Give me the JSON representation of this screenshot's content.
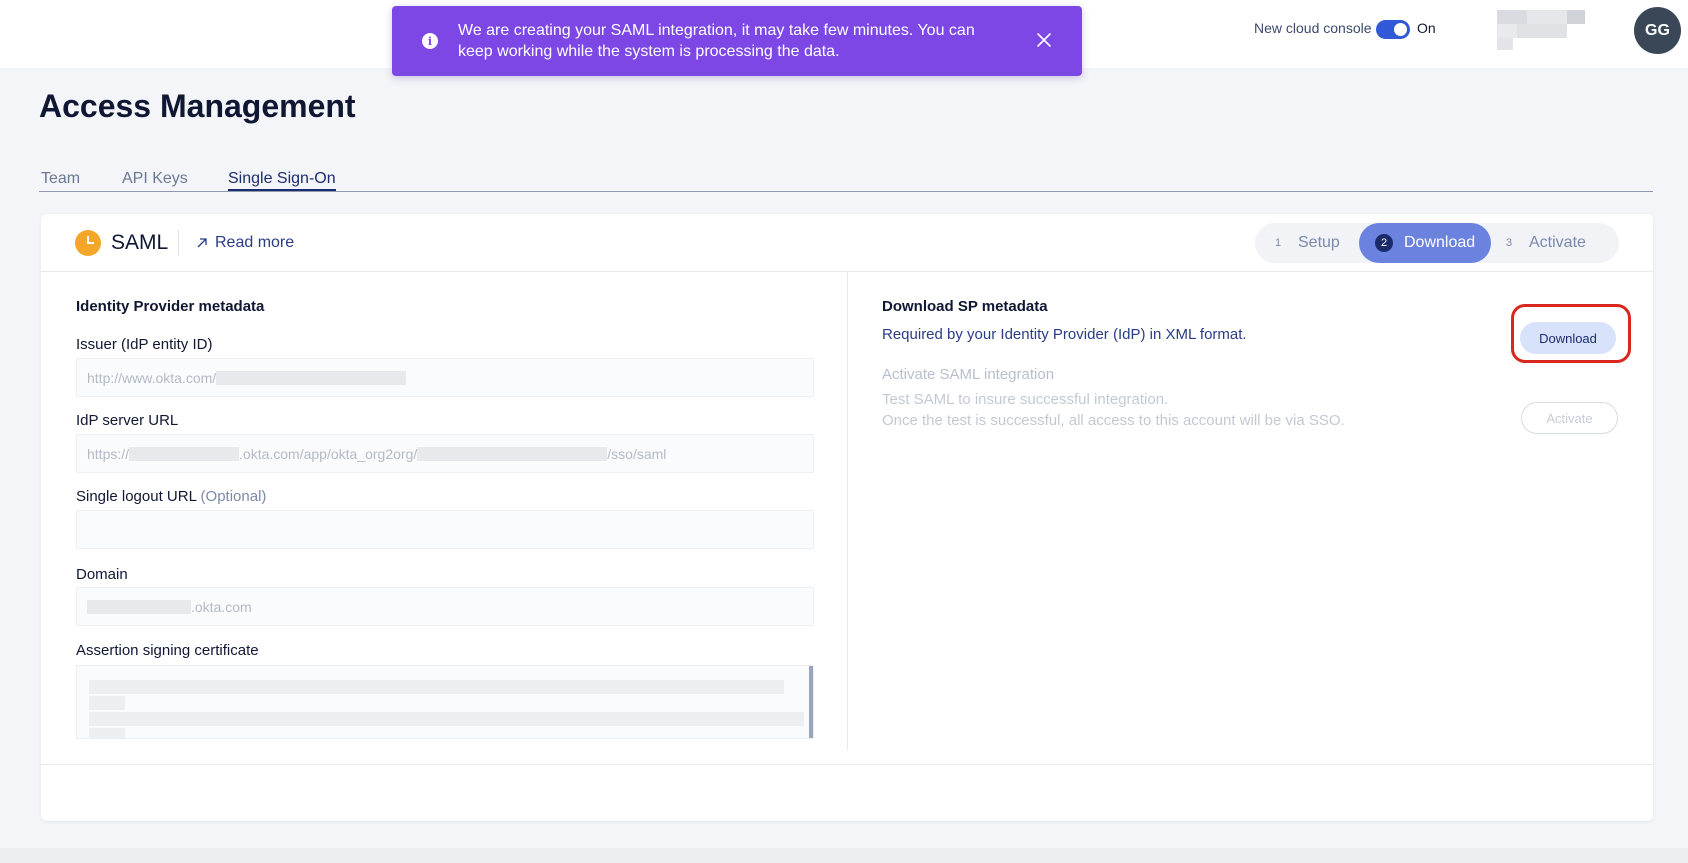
{
  "header": {
    "toast_message": "We are creating your SAML integration, it may take few minutes. You can keep working while the system is processing the data.",
    "console_label": "New cloud console",
    "console_toggle_state": "On",
    "avatar_initials": "GG"
  },
  "page": {
    "title": "Access Management",
    "tabs": [
      {
        "label": "Team"
      },
      {
        "label": "API Keys"
      },
      {
        "label": "Single Sign-On"
      }
    ],
    "active_tab": "Single Sign-On"
  },
  "card": {
    "title": "SAML",
    "read_more": "Read more",
    "steps": [
      {
        "num": "1",
        "label": "Setup"
      },
      {
        "num": "2",
        "label": "Download"
      },
      {
        "num": "3",
        "label": "Activate"
      }
    ],
    "active_step": "Download"
  },
  "idp": {
    "section_title": "Identity Provider metadata",
    "issuer_label": "Issuer (IdP entity ID)",
    "issuer_value_prefix": "http://www.okta.com/",
    "server_url_label": "IdP server URL",
    "server_url_a": "https://",
    "server_url_b": ".okta.com/app/okta_org2org/",
    "server_url_c": "/sso/saml",
    "logout_label": "Single logout URL",
    "logout_optional": "(Optional)",
    "domain_label": "Domain",
    "domain_suffix": ".okta.com",
    "cert_label": "Assertion signing certificate"
  },
  "sp": {
    "download_title": "Download SP metadata",
    "download_desc": "Required by your Identity Provider (IdP) in XML format.",
    "download_button": "Download",
    "activate_title": "Activate SAML integration",
    "activate_desc_1": "Test SAML to insure successful integration.",
    "activate_desc_2": "Once the test is successful, all access to this account will be via SSO.",
    "activate_button": "Activate"
  },
  "colors": {
    "toast": "#7d47e6",
    "accent": "#3158d6",
    "active_step": "#6b82de",
    "highlight": "#d7271e"
  }
}
